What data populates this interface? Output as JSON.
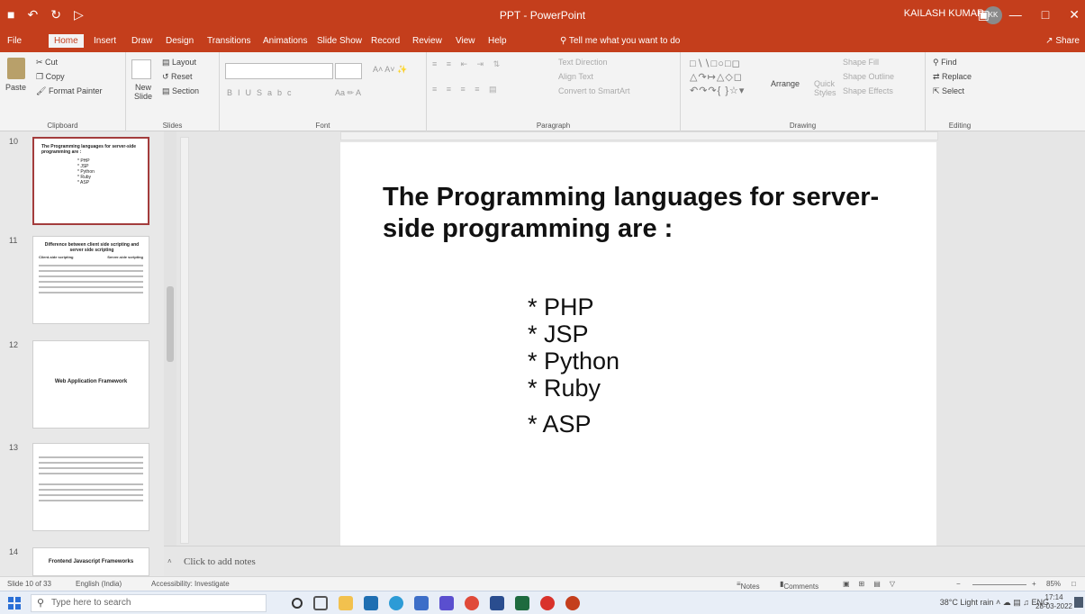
{
  "app": {
    "window_title": "PPT - PowerPoint",
    "user_name": "KAILASH KUMAR",
    "user_initials": "KK"
  },
  "ribbon_tabs": [
    "File",
    "Home",
    "Insert",
    "Draw",
    "Design",
    "Transitions",
    "Animations",
    "Slide Show",
    "Record",
    "Review",
    "View",
    "Help"
  ],
  "active_tab": "Home",
  "tell_me": "Tell me what you want to do",
  "share_label": "Share",
  "clipboard": {
    "paste": "Paste",
    "cut": "Cut",
    "copy": "Copy",
    "format_painter": "Format Painter",
    "label": "Clipboard"
  },
  "slides_group": {
    "new_slide": "New Slide",
    "layout": "Layout",
    "reset": "Reset",
    "section": "Section",
    "label": "Slides"
  },
  "font_group": {
    "label": "Font"
  },
  "paragraph_group": {
    "text_direction": "Text Direction",
    "align_text": "Align Text",
    "convert_smartart": "Convert to SmartArt",
    "label": "Paragraph"
  },
  "drawing_group": {
    "arrange": "Arrange",
    "quick_styles": "Quick Styles",
    "shape_fill": "Shape Fill",
    "shape_outline": "Shape Outline",
    "shape_effects": "Shape Effects",
    "label": "Drawing"
  },
  "editing_group": {
    "find": "Find",
    "replace": "Replace",
    "select": "Select",
    "label": "Editing"
  },
  "thumbnails": [
    {
      "num": "10",
      "title": "The Programming languages for server-side programming are :",
      "items": [
        "* PHP",
        "* JSP",
        "* Python",
        "* Ruby",
        "* ASP"
      ]
    },
    {
      "num": "11",
      "title": "Difference between client side scripting and server side scripting",
      "col_left": "Client-side scripting",
      "col_right": "Server-side scripting"
    },
    {
      "num": "12",
      "title": "Web Application Framework"
    },
    {
      "num": "13"
    },
    {
      "num": "14",
      "title": "Frontend Javascript Frameworks"
    }
  ],
  "slide": {
    "title": "The Programming languages for server-side programming are :",
    "items": [
      "* PHP",
      "* JSP",
      "* Python",
      "* Ruby",
      "* ASP"
    ]
  },
  "notes_placeholder": "Click to add notes",
  "statusbar": {
    "slide_count": "Slide 10 of 33",
    "language": "English (India)",
    "accessibility": "Accessibility: Investigate",
    "notes": "Notes",
    "comments": "Comments",
    "zoom": "85%"
  },
  "taskbar": {
    "search_placeholder": "Type here to search",
    "weather": "38°C Light rain",
    "lang": "ENG",
    "time": "17:14",
    "date": "28-03-2022"
  }
}
